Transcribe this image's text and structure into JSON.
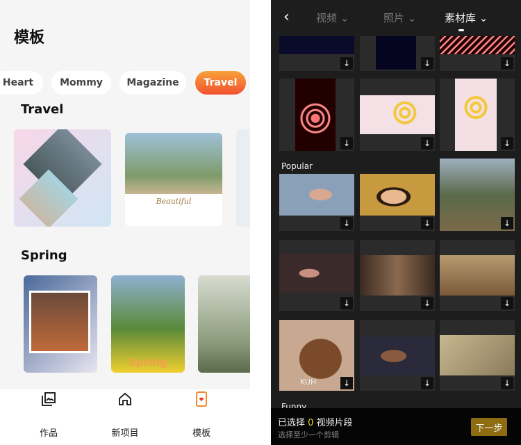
{
  "left": {
    "title": "模板",
    "chips": [
      {
        "label": "Heart"
      },
      {
        "label": "Mommy"
      },
      {
        "label": "Magazine"
      },
      {
        "label": "Travel",
        "active": true
      }
    ],
    "sections": [
      {
        "title": "Travel"
      },
      {
        "title": "Spring"
      }
    ],
    "card_text": {
      "beautiful": "Beautiful",
      "spring": "Spring"
    },
    "tabbar": [
      {
        "label": "作品",
        "icon": "gallery-icon"
      },
      {
        "label": "新项目",
        "icon": "home-icon"
      },
      {
        "label": "模板",
        "icon": "template-heart-icon",
        "active": true
      }
    ]
  },
  "right": {
    "tabs": [
      {
        "label": "视频"
      },
      {
        "label": "照片"
      },
      {
        "label": "素材库",
        "active": true
      }
    ],
    "sections": [
      {
        "title": "Popular"
      },
      {
        "title": "Funny"
      }
    ],
    "cell_text": {
      "kuh": "KUH"
    },
    "bottom": {
      "selected_prefix": "已选择",
      "selected_count": "0",
      "selected_suffix": "视频片段",
      "hint": "选择至少一个剪辑",
      "next_label": "下一步"
    },
    "accent": "#8e6c12"
  }
}
